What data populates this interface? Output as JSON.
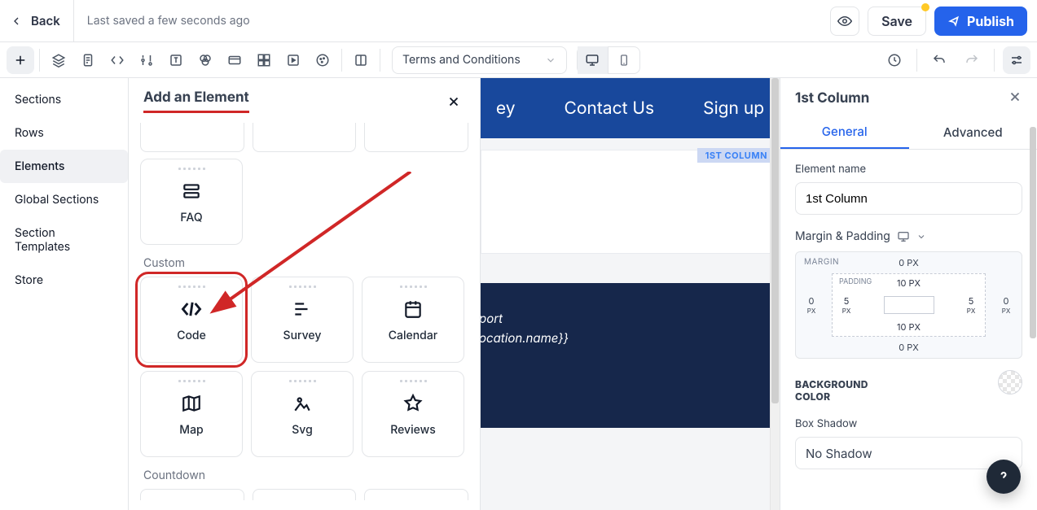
{
  "header": {
    "back": "Back",
    "saved": "Last saved a few seconds ago",
    "save": "Save",
    "publish": "Publish"
  },
  "page_select": {
    "label": "Terms and Conditions"
  },
  "leftnav": {
    "items": [
      {
        "label": "Sections"
      },
      {
        "label": "Rows"
      },
      {
        "label": "Elements"
      },
      {
        "label": "Global Sections"
      },
      {
        "label": "Section Templates"
      },
      {
        "label": "Store"
      }
    ],
    "active_index": 2
  },
  "elements_panel": {
    "title": "Add an Element",
    "faq_label": "FAQ",
    "custom_label": "Custom",
    "custom_items": [
      {
        "label": "Code",
        "icon": "code-icon",
        "highlight": true
      },
      {
        "label": "Survey",
        "icon": "survey-icon"
      },
      {
        "label": "Calendar",
        "icon": "calendar-icon"
      }
    ],
    "custom_row2": [
      {
        "label": "Map",
        "icon": "map-icon"
      },
      {
        "label": "Svg",
        "icon": "svg-icon"
      },
      {
        "label": "Reviews",
        "icon": "reviews-icon"
      }
    ],
    "countdown_label": "Countdown"
  },
  "canvas": {
    "nav_items": [
      "ey",
      "Contact Us",
      "Sign up"
    ],
    "column_tag": "1ST COLUMN",
    "hero_lines": [
      "port",
      "ocation.name}}"
    ]
  },
  "inspector": {
    "title": "1st Column",
    "tabs": {
      "general": "General",
      "advanced": "Advanced"
    },
    "element_name_label": "Element name",
    "element_name_value": "1st Column",
    "mp_label": "Margin & Padding",
    "margin_label": "MARGIN",
    "padding_label": "PADDING",
    "margin": {
      "top": "0 PX",
      "bottom": "0 PX",
      "left": "0",
      "left_unit": "PX",
      "right": "0",
      "right_unit": "PX"
    },
    "padding": {
      "top": "10 PX",
      "bottom": "10 PX",
      "left": "5",
      "left_unit": "PX",
      "right": "5",
      "right_unit": "PX"
    },
    "bg_label": "BACKGROUND COLOR",
    "box_shadow_label": "Box Shadow",
    "box_shadow_value": "No Shadow"
  }
}
